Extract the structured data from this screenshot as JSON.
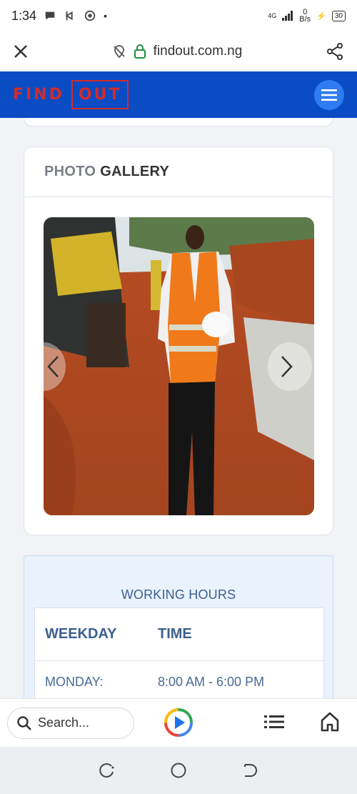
{
  "status_bar": {
    "time": "1:34",
    "network": "4G",
    "speed_value": "0",
    "speed_unit": "B/s",
    "battery": "30"
  },
  "browser": {
    "url": "findout.com.ng"
  },
  "header": {
    "logo_part1": "FIND",
    "logo_part2": "OUT",
    "accent_color": "#0a4cc4",
    "logo_color": "#d32b2b"
  },
  "gallery": {
    "title_light": "PHOTO",
    "title_bold": "GALLERY"
  },
  "working_hours": {
    "title": "WORKING HOURS",
    "col_weekday": "WEEKDAY",
    "col_time": "TIME",
    "rows": [
      {
        "day": "MONDAY:",
        "time": "8:00 AM - 6:00 PM"
      }
    ]
  },
  "bottom_bar": {
    "search_placeholder": "Search..."
  },
  "icons": [
    "close-icon",
    "lock-icon",
    "share-icon",
    "hamburger-icon",
    "chevron-left-icon",
    "chevron-right-icon",
    "search-icon",
    "play-icon",
    "list-icon",
    "home-icon"
  ]
}
